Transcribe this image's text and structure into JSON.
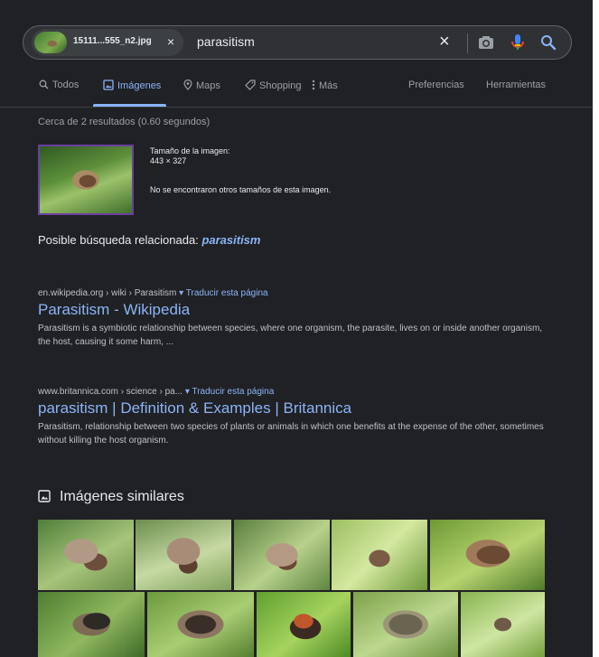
{
  "search": {
    "chip_filename": "15111...555_n2.jpg",
    "chip_close": "×",
    "query": "parasitism",
    "clear": "×"
  },
  "tabs": [
    {
      "label": "Todos",
      "icon": "search-icon",
      "active": false
    },
    {
      "label": "Imágenes",
      "icon": "image-icon",
      "active": true
    },
    {
      "label": "Maps",
      "icon": "map-pin-icon",
      "active": false
    },
    {
      "label": "Shopping",
      "icon": "tag-icon",
      "active": false
    },
    {
      "label": "Más",
      "icon": "more-vert-icon",
      "active": false
    },
    {
      "label": "Preferencias",
      "active": false
    },
    {
      "label": "Herramientas",
      "active": false
    }
  ],
  "stats": "Cerca de 2 resultados (0.60 segundos)",
  "image_info": {
    "size_label": "Tamaño de la imagen:",
    "size_value": "443 × 327",
    "no_sizes": "No se encontraron otros tamaños de esta imagen."
  },
  "related": {
    "prefix": "Posible búsqueda relacionada:",
    "term": "parasitism"
  },
  "results": [
    {
      "crumb": "en.wikipedia.org › wiki › Parasitism",
      "translate": "Traducir esta página",
      "title": "Parasitism - Wikipedia",
      "snippet": "Parasitism is a symbiotic relationship between species, where one organism, the parasite, lives on or inside another organism, the host, causing it some harm, ..."
    },
    {
      "crumb": "www.britannica.com › science › pa...",
      "translate": "Traducir esta página",
      "title": "parasitism | Definition & Examples | Britannica",
      "snippet": "Parasitism, relationship between two species of plants or animals in which one benefits at the expense of the other, sometimes without killing the host organism."
    }
  ],
  "similar": {
    "heading": "Imágenes similares"
  },
  "colors": {
    "background": "#202124",
    "link": "#8ab4f8",
    "text": "#bdc1c6",
    "mic_yellow": "#fbbc04"
  }
}
